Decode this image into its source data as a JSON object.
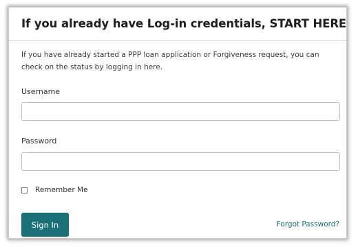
{
  "login_card": {
    "title": "If you already have Log-in credentials, START HERE",
    "intro": "If you have already started a PPP loan application or Forgiveness request, you can check on the status by logging in here.",
    "username_label": "Username",
    "username_value": "",
    "password_label": "Password",
    "password_value": "",
    "remember_label": "Remember Me",
    "remember_checked": false,
    "signin_label": "Sign In",
    "forgot_label": "Forgot Password?"
  },
  "colors": {
    "accent": "#1b6f77",
    "title_text": "#1f1f1f",
    "body_text": "#3a3a3a"
  }
}
